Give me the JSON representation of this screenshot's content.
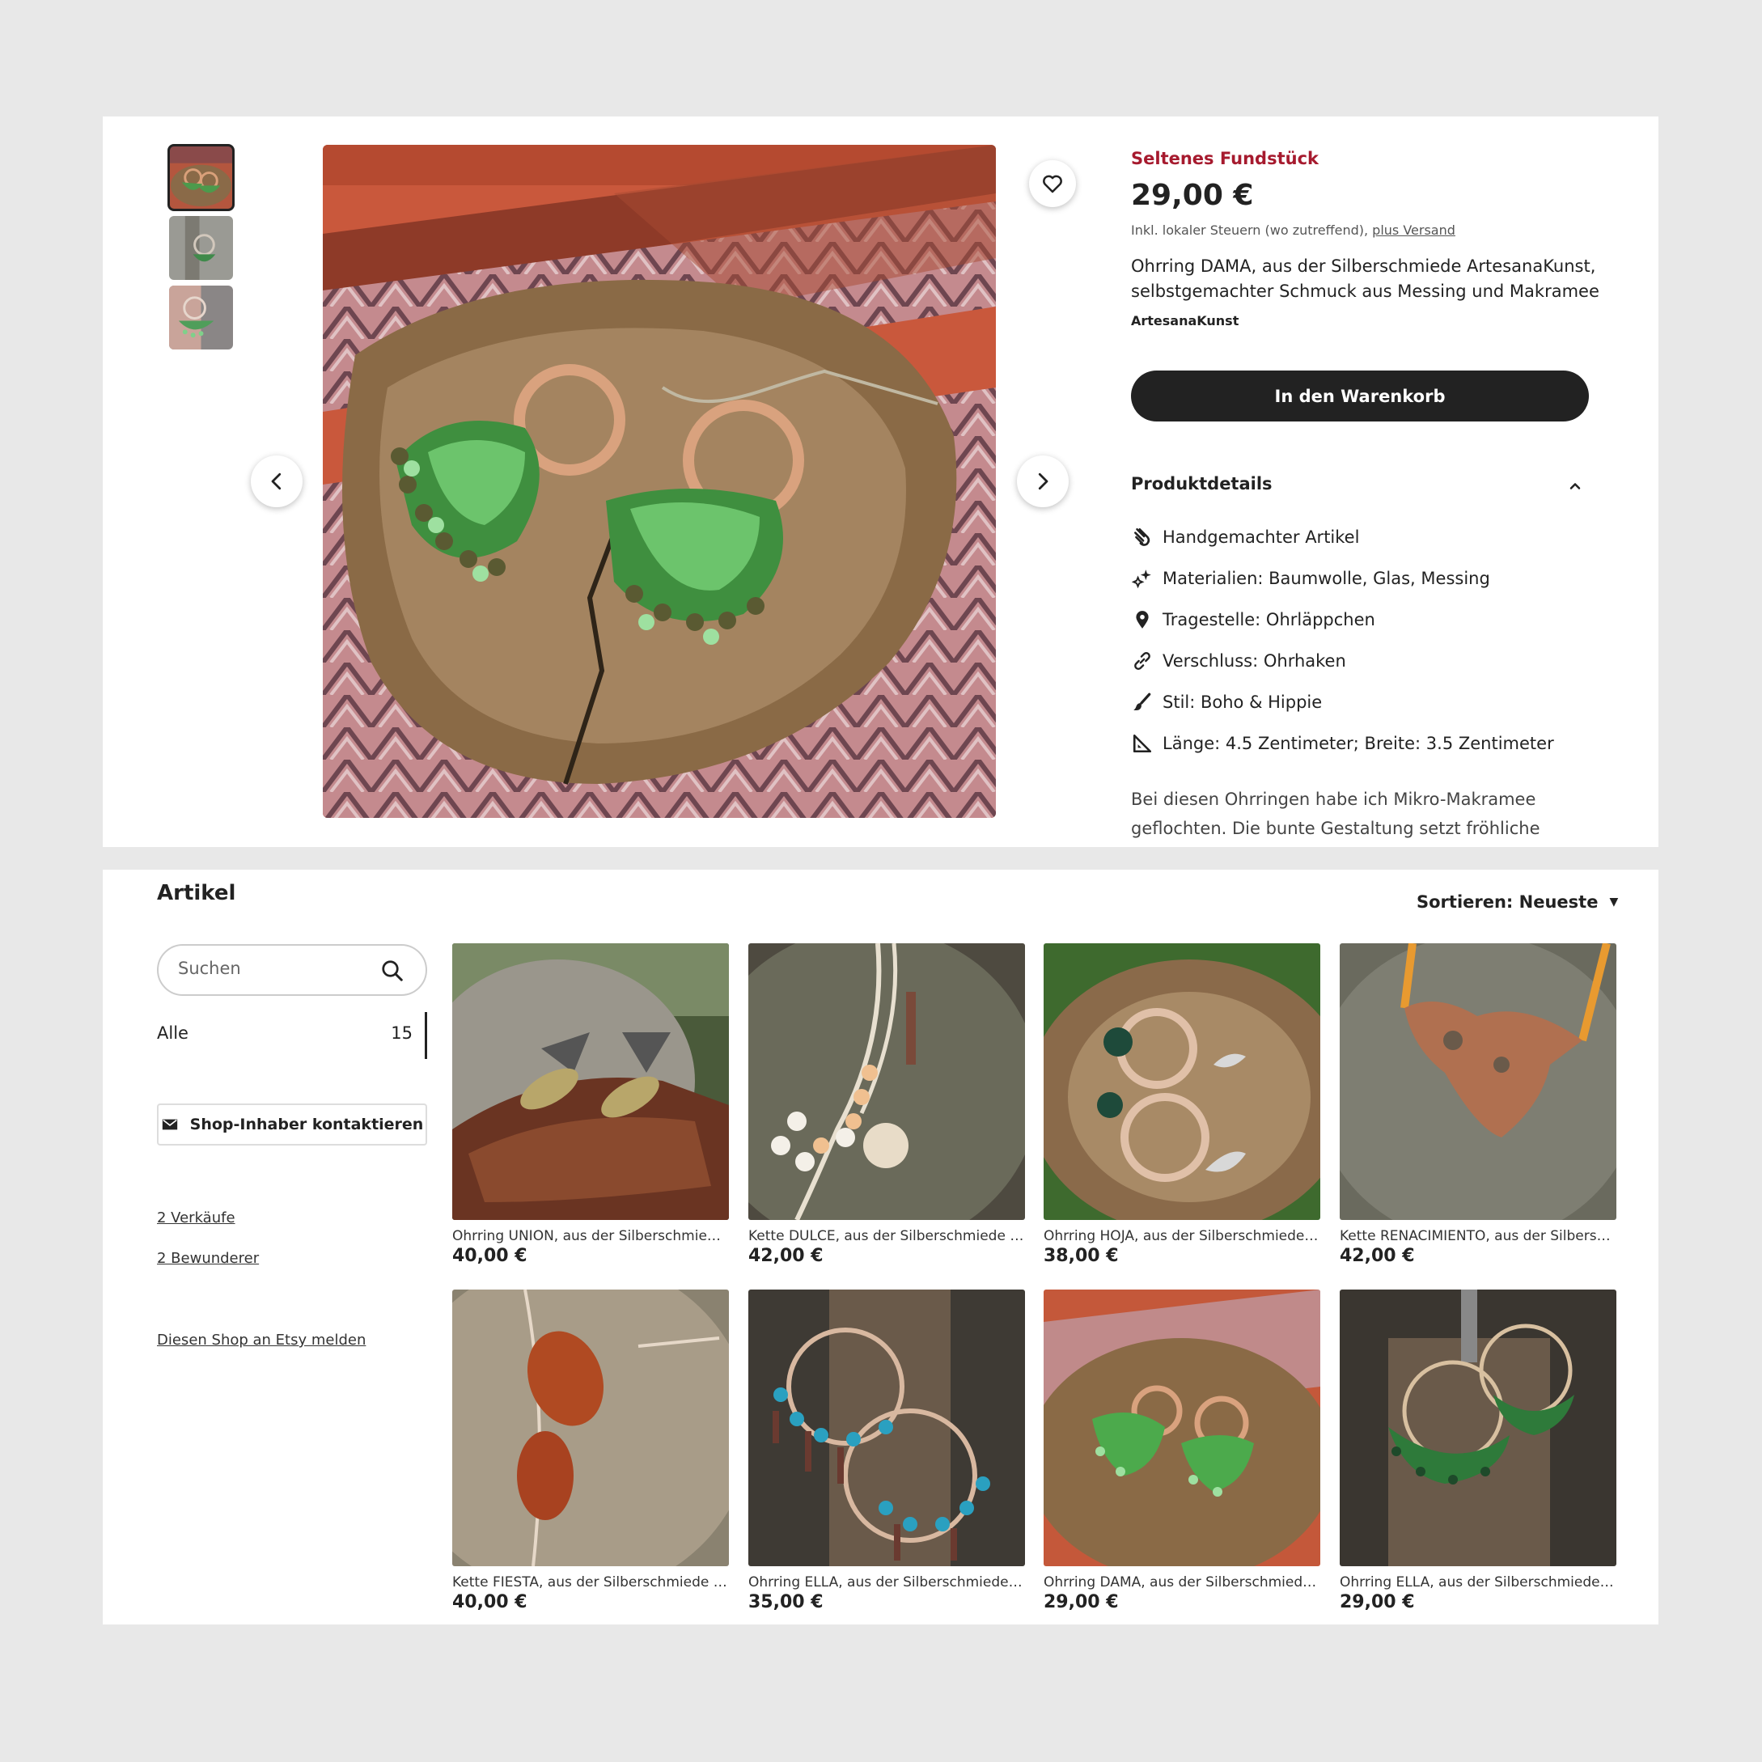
{
  "listing": {
    "badge": "Seltenes Fundstück",
    "price": "29,00 €",
    "tax_note": "Inkl. lokaler Steuern (wo zutreffend), ",
    "shipping_link": "plus Versand",
    "title": "Ohrring DAMA, aus der Silberschmiede ArtesanaKunst, selbstgemachter Schmuck aus Messing und Makramee",
    "shop_name": "ArtesanaKunst",
    "cart_button": "In den Warenkorb",
    "details_heading": "Produktdetails",
    "details": [
      {
        "icon": "handmade-icon",
        "text": "Handgemachter Artikel"
      },
      {
        "icon": "materials-sparkle-icon",
        "text": "Materialien: Baumwolle, Glas, Messing"
      },
      {
        "icon": "location-pin-icon",
        "text": "Tragestelle: Ohrläppchen"
      },
      {
        "icon": "link-chain-icon",
        "text": "Verschluss: Ohrhaken"
      },
      {
        "icon": "paintbrush-icon",
        "text": "Stil: Boho & Hippie"
      },
      {
        "icon": "ruler-triangle-icon",
        "text": "Länge: 4.5 Zentimeter; Breite: 3.5 Zentimeter"
      }
    ],
    "description": "Bei diesen Ohrringen habe ich Mikro-Makramee geflochten. Die bunte Gestaltung setzt fröhliche"
  },
  "shop": {
    "items_title": "Artikel",
    "sort_label": "Sortieren: Neueste",
    "search_placeholder": "Suchen",
    "filter_all_label": "Alle",
    "filter_all_count": "15",
    "contact_button": "Shop-Inhaber kontaktieren",
    "sales_link": "2 Verkäufe",
    "admirers_link": "2 Bewunderer",
    "report_link": "Diesen Shop an Etsy melden",
    "products": [
      {
        "name": "Ohrring UNION, aus der Silberschmiede ArtesanaKunst",
        "price": "40,00 €"
      },
      {
        "name": "Kette DULCE, aus der Silberschmiede ArtesanaKunst",
        "price": "42,00 €"
      },
      {
        "name": "Ohrring HOJA, aus der Silberschmiede ArtesanaKunst",
        "price": "38,00 €"
      },
      {
        "name": "Kette RENACIMIENTO, aus der Silberschmiede ArtesanaKunst",
        "price": "42,00 €"
      },
      {
        "name": "Kette FIESTA, aus der Silberschmiede ArtesanaKunst",
        "price": "40,00 €"
      },
      {
        "name": "Ohrring ELLA, aus der Silberschmiede ArtesanaKunst",
        "price": "35,00 €"
      },
      {
        "name": "Ohrring DAMA, aus der Silberschmiede ArtesanaKunst",
        "price": "29,00 €"
      },
      {
        "name": "Ohrring ELLA, aus der Silberschmiede ArtesanaKunst",
        "price": "29,00 €"
      }
    ]
  },
  "colors": {
    "accent_badge": "#a61a2e",
    "button_dark": "#222222",
    "page_bg": "#e8e8e8"
  }
}
